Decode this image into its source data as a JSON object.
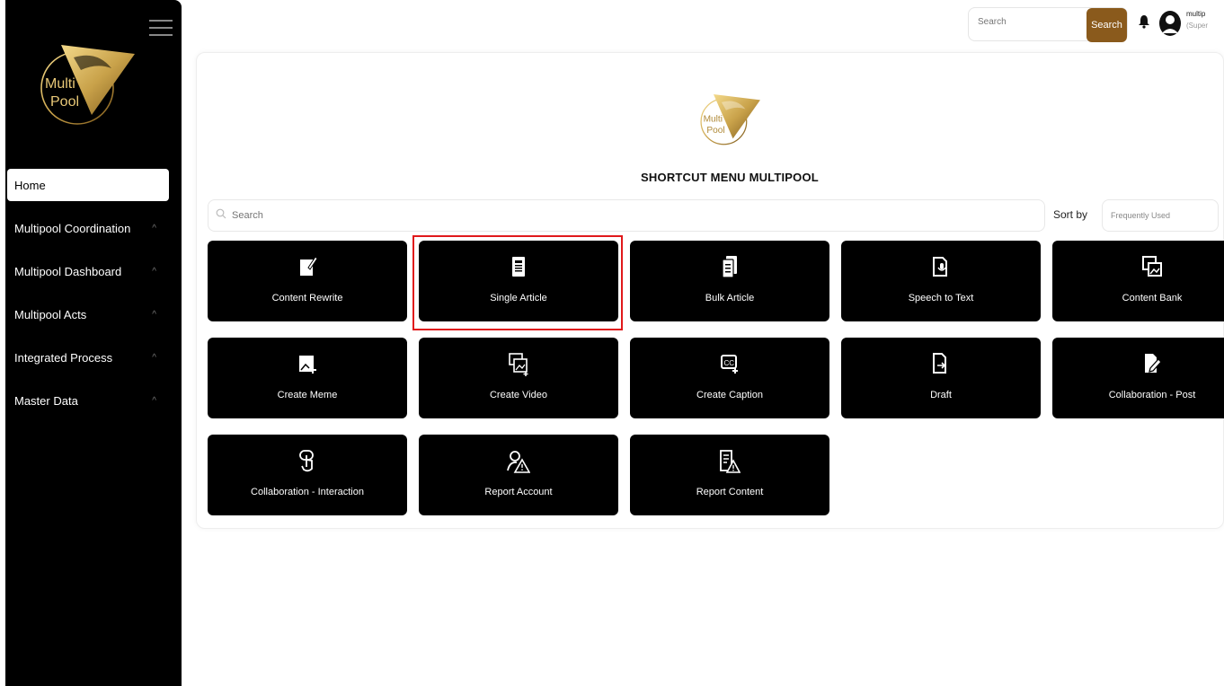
{
  "sidebar": {
    "logo_text_1": "Multi",
    "logo_text_2": "Pool",
    "items": [
      {
        "label": "Home"
      },
      {
        "label": "Multipool Coordination"
      },
      {
        "label": "Multipool Dashboard"
      },
      {
        "label": "Multipool Acts"
      },
      {
        "label": "Integrated Process"
      },
      {
        "label": "Master Data"
      }
    ],
    "chevron": "^"
  },
  "topbar": {
    "search_placeholder": "Search",
    "search_button": "Search",
    "user_name": "multip",
    "user_role": "(Super"
  },
  "main": {
    "title": "SHORTCUT MENU MULTIPOOL",
    "search_placeholder": "Search",
    "sort_label": "Sort by",
    "sort_value": "Frequently Used",
    "cards": [
      {
        "label": "Content Rewrite",
        "icon": "edit-document-icon"
      },
      {
        "label": "Single Article",
        "icon": "article-icon"
      },
      {
        "label": "Bulk Article",
        "icon": "bulk-article-icon"
      },
      {
        "label": "Speech to Text",
        "icon": "speech-to-text-icon"
      },
      {
        "label": "Content Bank",
        "icon": "content-bank-icon"
      },
      {
        "label": "Create Meme",
        "icon": "create-meme-icon"
      },
      {
        "label": "Create Video",
        "icon": "create-video-icon"
      },
      {
        "label": "Create Caption",
        "icon": "create-caption-icon"
      },
      {
        "label": "Draft",
        "icon": "draft-icon"
      },
      {
        "label": "Collaboration - Post",
        "icon": "collaboration-post-icon"
      },
      {
        "label": "Collaboration - Interaction",
        "icon": "touch-icon"
      },
      {
        "label": "Report Account",
        "icon": "report-account-icon"
      },
      {
        "label": "Report Content",
        "icon": "report-content-icon"
      }
    ]
  },
  "colors": {
    "accent": "#8a5a1c",
    "gold": "#c9a24a",
    "highlight": "#e0191b"
  }
}
